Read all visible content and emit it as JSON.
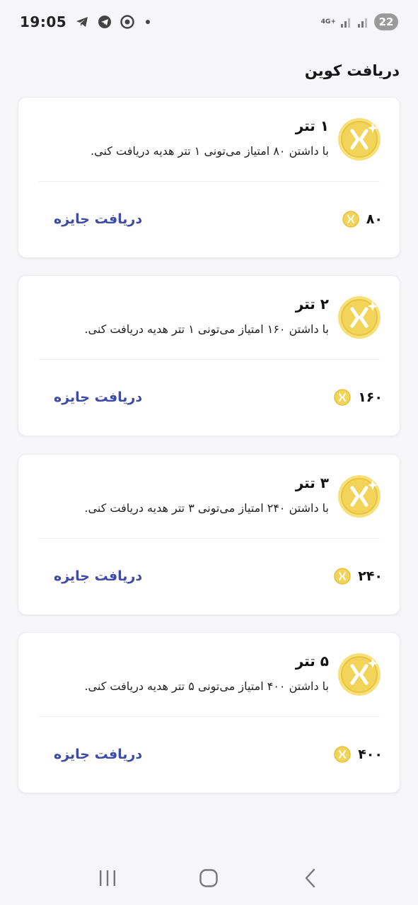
{
  "status_bar": {
    "time": "19:05",
    "network_label": "4G+",
    "battery": "22",
    "icons": [
      "telegram-icon",
      "telegram-icon",
      "chrome-icon",
      "notification-dot",
      "signal-icon",
      "signal-icon",
      "battery-icon"
    ]
  },
  "page": {
    "title": "دریافت کوین"
  },
  "rewards": [
    {
      "title": "۱ تتر",
      "description": "با داشتن ۸۰ امتیاز می‌تونی ۱ تتر هدیه دریافت کنی.",
      "points": "۸۰",
      "button_label": "دریافت جایزه"
    },
    {
      "title": "۲ تتر",
      "description": "با داشتن ۱۶۰ امتیاز می‌تونی ۱ تتر هدیه دریافت کنی.",
      "points": "۱۶۰",
      "button_label": "دریافت جایزه"
    },
    {
      "title": "۳ تتر",
      "description": "با داشتن ۲۴۰ امتیاز می‌تونی ۳ تتر هدیه دریافت کنی.",
      "points": "۲۴۰",
      "button_label": "دریافت جایزه"
    },
    {
      "title": "۵ تتر",
      "description": "با داشتن ۴۰۰ امتیاز می‌تونی ۵ تتر هدیه دریافت کنی.",
      "points": "۴۰۰",
      "button_label": "دریافت جایزه"
    }
  ],
  "nav_bar": {
    "items": [
      "recent-apps-icon",
      "home-icon",
      "back-icon"
    ]
  },
  "colors": {
    "accent": "#3d4aa8",
    "coin": "#f3d45a",
    "background": "#f6f6f8"
  }
}
